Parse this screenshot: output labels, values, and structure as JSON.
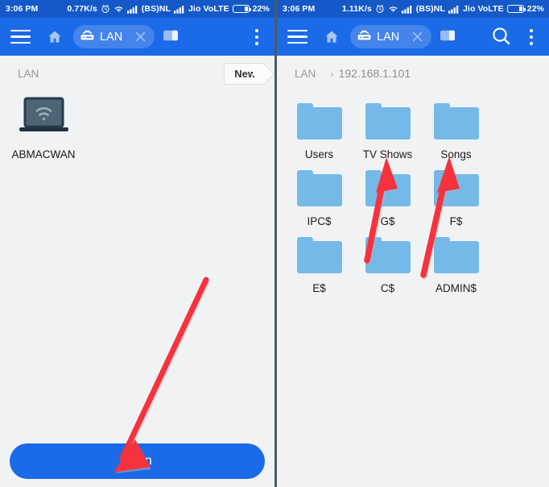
{
  "statusbar": {
    "time": "3:06 PM",
    "left_speed": "0.77K/s",
    "right_speed": "1.11K/s",
    "carrier1": "(BS)NL",
    "carrier2": "Jio VoLTE",
    "battery": "22%",
    "battery_percent": 22,
    "icons": [
      "alarm-clock-icon",
      "wifi-icon",
      "signal-bars-icon",
      "signal-bars-icon",
      "battery-icon"
    ],
    "bg_color": "#1559c9"
  },
  "toolbar": {
    "menu_label": "hamburger-menu",
    "home_label": "home",
    "tab_label": "LAN",
    "tab_close_label": "close-tab",
    "windows_label": "windows",
    "search_label": "search",
    "overflow_label": "more-options",
    "bg_color": "#1b6ae8"
  },
  "left_panel": {
    "breadcrumb": {
      "root": "LAN"
    },
    "new_button": "New",
    "devices": [
      {
        "name": "ABMACWAN",
        "icon": "laptop-wifi-icon"
      }
    ],
    "scan_button": "Scan",
    "scan_color": "#1b6ae8"
  },
  "right_panel": {
    "breadcrumb": {
      "root": "LAN",
      "separator": "›",
      "path": "192.168.1.101"
    },
    "folders": [
      {
        "name": "Users"
      },
      {
        "name": "TV Shows"
      },
      {
        "name": "Songs"
      },
      {
        "name": "IPC$"
      },
      {
        "name": "G$"
      },
      {
        "name": "F$"
      },
      {
        "name": "E$"
      },
      {
        "name": "C$"
      },
      {
        "name": "ADMIN$"
      }
    ],
    "folder_color": "#74b9e7"
  },
  "annotations": {
    "color": "#f5333f",
    "arrows": [
      {
        "name": "arrow-to-scan-button",
        "panel": "left",
        "points_to": "Scan"
      },
      {
        "name": "arrow-to-tv-shows",
        "panel": "right",
        "points_to": "TV Shows"
      },
      {
        "name": "arrow-to-songs",
        "panel": "right",
        "points_to": "Songs"
      }
    ]
  }
}
